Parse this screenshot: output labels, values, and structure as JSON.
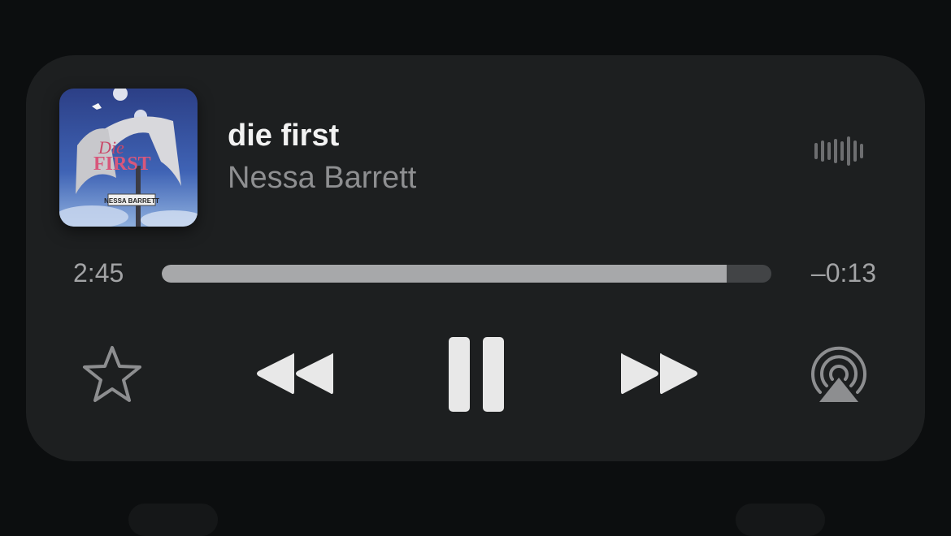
{
  "now_playing": {
    "title": "die first",
    "artist": "Nessa Barrett",
    "artwork": {
      "text_line1": "Die",
      "text_line2": "FIRST",
      "text_sign": "NESSA BARRETT"
    },
    "progress": {
      "elapsed": "2:45",
      "remaining": "–0:13",
      "fraction": 0.927
    }
  },
  "controls": {
    "favorite_icon": "star-icon",
    "rewind_icon": "rewind-icon",
    "pause_icon": "pause-icon",
    "forward_icon": "fast-forward-icon",
    "airplay_icon": "airplay-audio-icon",
    "waveform_icon": "waveform-icon"
  },
  "colors": {
    "card_background": "#1d1f20",
    "title_text": "#f2f2f2",
    "secondary_text": "#8e8f91",
    "progress_fill": "#a7a8aa",
    "progress_track": "#424446",
    "control_icon": "#e8e8e8"
  }
}
